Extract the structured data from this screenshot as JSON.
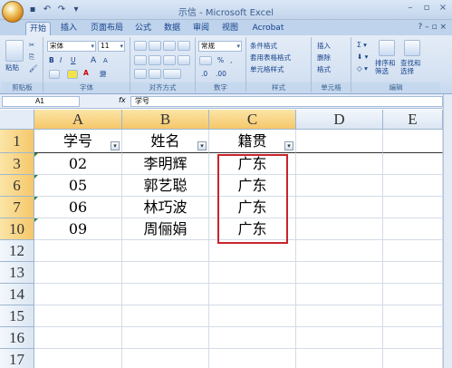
{
  "window": {
    "title": "示信 - Microsoft Excel",
    "controls": [
      "minimize",
      "restore",
      "close"
    ]
  },
  "quick_access": [
    "save-icon",
    "undo-icon",
    "redo-icon",
    "customize-icon"
  ],
  "tabs": [
    {
      "label": "开始",
      "active": true
    },
    {
      "label": "插入"
    },
    {
      "label": "页面布局"
    },
    {
      "label": "公式"
    },
    {
      "label": "数据"
    },
    {
      "label": "审阅"
    },
    {
      "label": "视图"
    },
    {
      "label": "Acrobat"
    }
  ],
  "ribbon": {
    "clipboard": {
      "label": "剪贴板",
      "paste": "粘贴"
    },
    "font": {
      "label": "字体",
      "name": "宋体",
      "size": "11",
      "bold": "B",
      "italic": "I",
      "underline": "U",
      "grow": "A",
      "shrink": "A"
    },
    "alignment": {
      "label": "对齐方式"
    },
    "number": {
      "label": "数字",
      "format": "常规",
      "percent": "%",
      "comma": ","
    },
    "styles": {
      "label": "样式",
      "conditional": "条件格式",
      "table": "套用表格格式",
      "cell": "单元格样式"
    },
    "cells": {
      "label": "单元格",
      "insert": "插入",
      "delete": "删除",
      "format": "格式"
    },
    "editing": {
      "label": "编辑",
      "sort": "排序和筛选",
      "find": "查找和选择"
    }
  },
  "formula_bar": {
    "name_box": "A1",
    "fx": "fx",
    "content": "学号"
  },
  "columns": [
    "A",
    "B",
    "C",
    "D",
    "E"
  ],
  "rows": [
    {
      "num": "1",
      "cells": [
        "学号",
        "姓名",
        "籍贯"
      ],
      "header": true
    },
    {
      "num": "3",
      "cells": [
        "02",
        "李明辉",
        "广东"
      ]
    },
    {
      "num": "6",
      "cells": [
        "05",
        "郭艺聪",
        "广东"
      ]
    },
    {
      "num": "7",
      "cells": [
        "06",
        "林巧波",
        "广东"
      ]
    },
    {
      "num": "10",
      "cells": [
        "09",
        "周俪娟",
        "广东"
      ]
    },
    {
      "num": "12",
      "cells": [
        "",
        "",
        ""
      ]
    },
    {
      "num": "13",
      "cells": [
        "",
        "",
        ""
      ]
    },
    {
      "num": "14",
      "cells": [
        "",
        "",
        ""
      ]
    },
    {
      "num": "15",
      "cells": [
        "",
        "",
        ""
      ]
    },
    {
      "num": "16",
      "cells": [
        "",
        "",
        ""
      ]
    },
    {
      "num": "17",
      "cells": [
        "",
        "",
        ""
      ]
    }
  ],
  "colors": {
    "highlight_border": "#c8242b",
    "selected_header": "#f5c76a"
  }
}
